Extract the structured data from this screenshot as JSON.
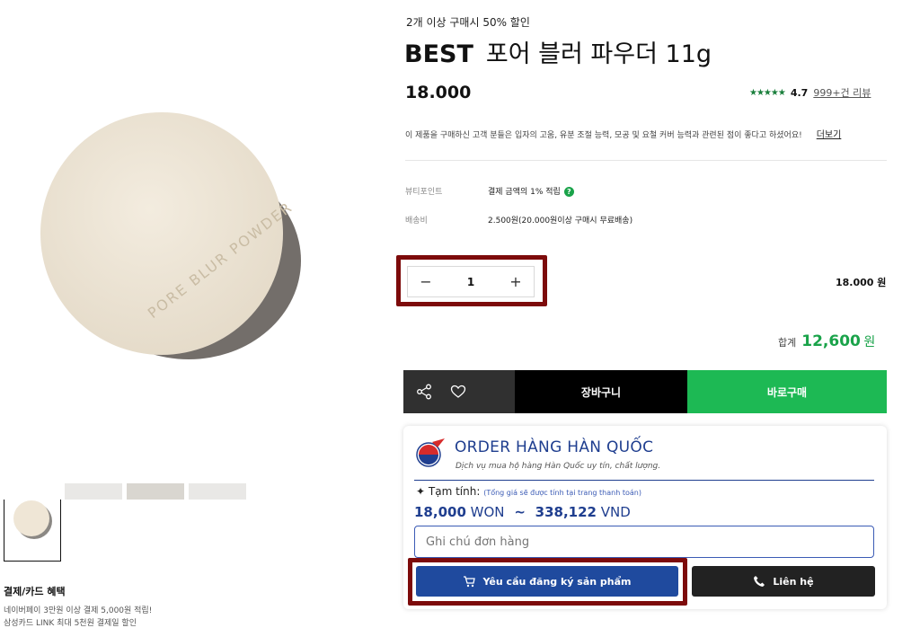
{
  "product": {
    "promo": "2개 이상 구매시 50% 할인",
    "badge": "BEST",
    "name": "포어 블러 파우더 11g",
    "price": "18.000",
    "rating": "4.7",
    "reviews": "999+건 리뷰",
    "description": "이 제품을 구매하신 고객 분들은 입자의 고움, 유분 조절 능력, 모공 및 요철 커버 능력과 관련된 점이 좋다고 하셨어요!",
    "more_link": "더보기",
    "image_text": "PORE BLUR POWDER"
  },
  "info": {
    "beauty_point_label": "뷰티포인트",
    "beauty_point_value": "결제 금액의 1% 적립",
    "shipping_label": "배송비",
    "shipping_value": "2.500원(20.000원이상 구매시 무료배송)"
  },
  "quantity": {
    "minus": "−",
    "value": "1",
    "plus": "+",
    "line_price": "18.000 원"
  },
  "total": {
    "label": "합계",
    "amount": "12,600",
    "unit": "원"
  },
  "actions": {
    "cart": "장바구니",
    "buy": "바로구매"
  },
  "benefits": {
    "title": "결제/카드 혜택",
    "line1": "네이버페이 3만원 이상 결제 5,000원 적립!",
    "line2": "삼성카드 LINK 최대 5천원 결제일 할인"
  },
  "order_widget": {
    "title": "ORDER HÀNG HÀN QUỐC",
    "subtitle": "Dịch vụ mua hộ hàng Hàn Quốc uy tín, chất lượng.",
    "tam_tinh_label": "Tạm tính:",
    "tam_tinh_note": "(Tổng giá sẽ được tính tại trang thanh toán)",
    "won_value": "18,000",
    "won_unit": "WON",
    "approx": "~",
    "vnd_value": "338,122",
    "vnd_unit": "VND",
    "note_placeholder": "Ghi chú đơn hàng",
    "request_button": "Yêu cầu đăng ký sản phẩm",
    "contact_button": "Liên hệ"
  },
  "colors": {
    "accent_green": "#1db954",
    "brand_blue": "#1f4a9e",
    "highlight": "#7d0b0b"
  }
}
